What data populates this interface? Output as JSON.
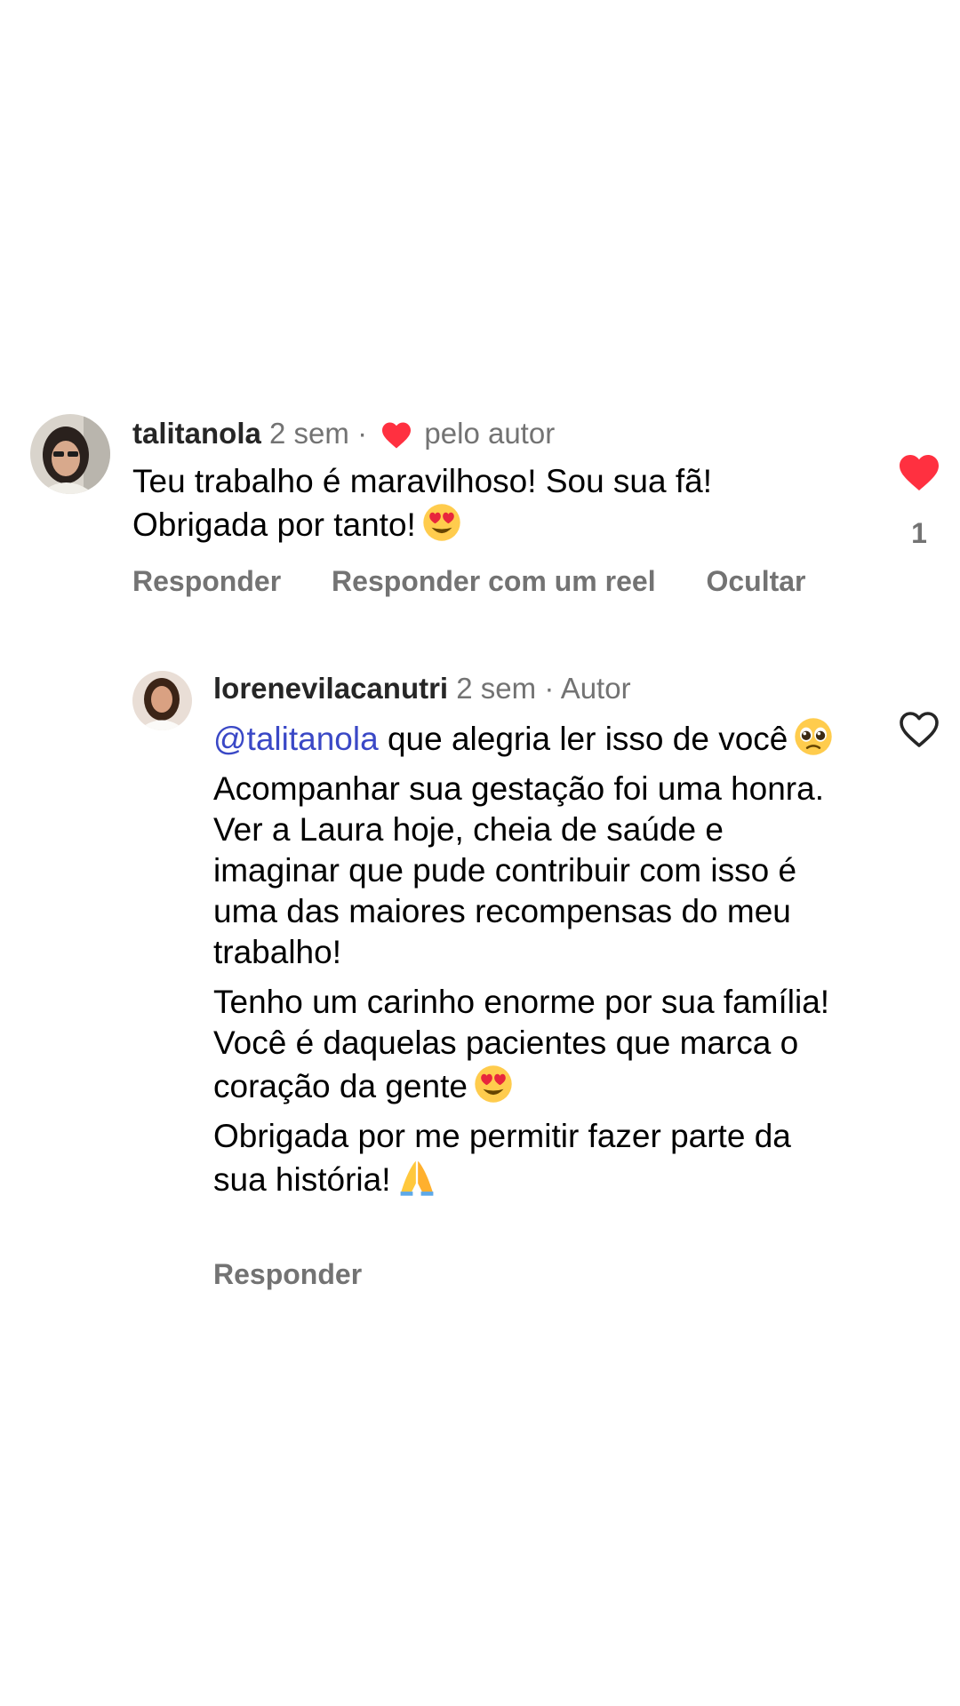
{
  "comments": [
    {
      "username": "talitanola",
      "time": "2 sem",
      "separator": "·",
      "liked_by_author_label": "pelo autor",
      "text_lines": [
        "Teu trabalho é maravilhoso! Sou sua fã!",
        "Obrigada por tanto!"
      ],
      "liked": true,
      "like_count": "1",
      "actions": [
        "Responder",
        "Responder com um reel",
        "Ocultar"
      ],
      "colors": {
        "heart": "#ff3040"
      }
    },
    {
      "username": "lorenevilacanutri",
      "time": "2 sem",
      "separator": "·",
      "author_label": "Autor",
      "mention": "@talitanola",
      "paragraphs": [
        "que alegria ler isso de você",
        "Acompanhar sua gestação foi uma honra. Ver a Laura hoje, cheia de saúde e imaginar que pude contribuir com isso é uma das maiores recompensas do meu trabalho!",
        "Tenho um carinho enorme por sua família! Você é daquelas pacientes que marca o coração da gente",
        "Obrigada por me permitir fazer parte da sua história!"
      ],
      "liked": false,
      "actions": [
        "Responder"
      ],
      "colors": {
        "mention": "#3a48c6"
      }
    }
  ],
  "icons": {
    "like_filled": "heart-filled-icon",
    "like_outline": "heart-outline-icon",
    "emoji_heart_eyes": "heart-eyes-emoji",
    "emoji_pleading": "pleading-face-emoji",
    "emoji_folded_hands": "folded-hands-emoji"
  }
}
